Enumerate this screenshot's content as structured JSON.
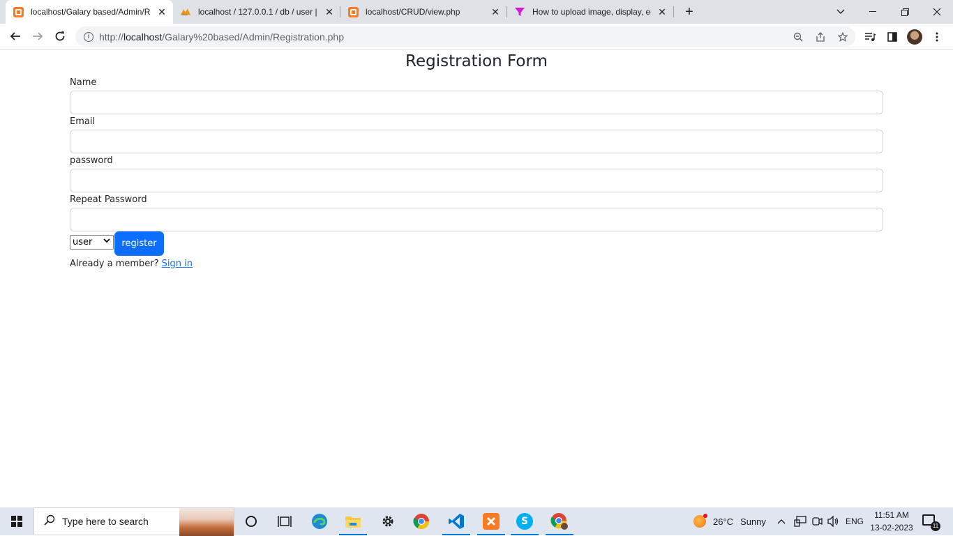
{
  "browser": {
    "tabs": [
      {
        "title": "localhost/Galary based/Admin/Re",
        "favicon": "xampp-icon",
        "active": true
      },
      {
        "title": "localhost / 127.0.0.1 / db / user |",
        "favicon": "phpmyadmin-icon",
        "active": false
      },
      {
        "title": "localhost/CRUD/view.php",
        "favicon": "xampp-icon",
        "active": false
      },
      {
        "title": "How to upload image, display, ec",
        "favicon": "funnel-icon",
        "active": false
      }
    ],
    "url_prefix": "http://",
    "url_host": "localhost",
    "url_path": "/Galary%20based/Admin/Registration.php"
  },
  "form": {
    "title": "Registration Form",
    "fields": [
      {
        "label": "Name",
        "value": ""
      },
      {
        "label": "Email",
        "value": ""
      },
      {
        "label": "password",
        "value": ""
      },
      {
        "label": "Repeat Password",
        "value": ""
      }
    ],
    "role_selected": "user",
    "register_label": "register",
    "member_text": "Already a member?",
    "signin_label": "Sign in"
  },
  "taskbar": {
    "search_placeholder": "Type here to search",
    "apps": [
      "cortana-icon",
      "task-view-icon",
      "edge-icon",
      "file-explorer-icon",
      "settings-icon",
      "chrome-icon",
      "vscode-icon",
      "xampp-icon",
      "skype-icon",
      "chrome-profile-icon"
    ],
    "weather_temp": "26°C",
    "weather_text": "Sunny",
    "language": "ENG",
    "time": "11:51 AM",
    "date": "13-02-2023",
    "notification_count": "11"
  },
  "colors": {
    "primary_button": "#0d6efd",
    "link": "#0d6efd",
    "xampp_orange": "#fb7a24"
  }
}
